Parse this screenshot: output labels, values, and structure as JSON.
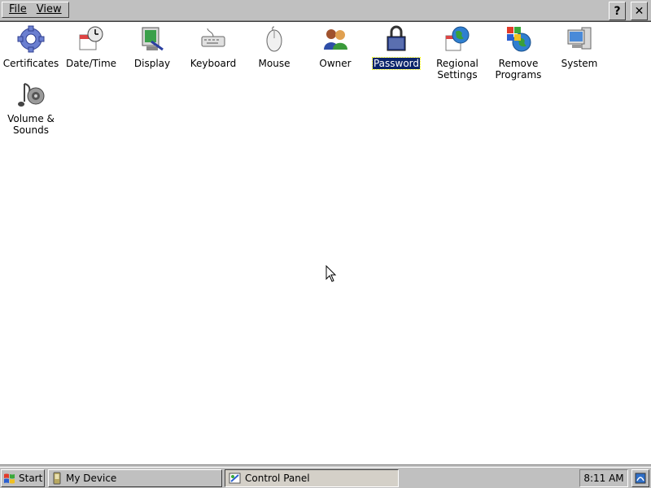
{
  "menu": {
    "file": "File",
    "view": "View"
  },
  "toolbar": {
    "help": "?",
    "close": "✕"
  },
  "items": [
    {
      "label": "Certificates",
      "icon": "certificates-icon"
    },
    {
      "label": "Date/Time",
      "icon": "datetime-icon"
    },
    {
      "label": "Display",
      "icon": "display-icon"
    },
    {
      "label": "Keyboard",
      "icon": "keyboard-icon"
    },
    {
      "label": "Mouse",
      "icon": "mouse-icon"
    },
    {
      "label": "Owner",
      "icon": "owner-icon"
    },
    {
      "label": "Password",
      "icon": "password-icon",
      "selected": true
    },
    {
      "label_line1": "Regional",
      "label_line2": "Settings",
      "icon": "regional-settings-icon"
    },
    {
      "label_line1": "Remove",
      "label_line2": "Programs",
      "icon": "remove-programs-icon"
    },
    {
      "label": "System",
      "icon": "system-icon"
    },
    {
      "label_line1": "Volume &",
      "label_line2": "Sounds",
      "icon": "volume-sounds-icon"
    }
  ],
  "taskbar": {
    "start": "Start",
    "tasks": [
      "My Device",
      "Control Panel"
    ],
    "clock": "8:11 AM"
  },
  "colors": {
    "selection": "#0a246a",
    "chrome": "#c0c0c0",
    "client": "#ffffff"
  }
}
